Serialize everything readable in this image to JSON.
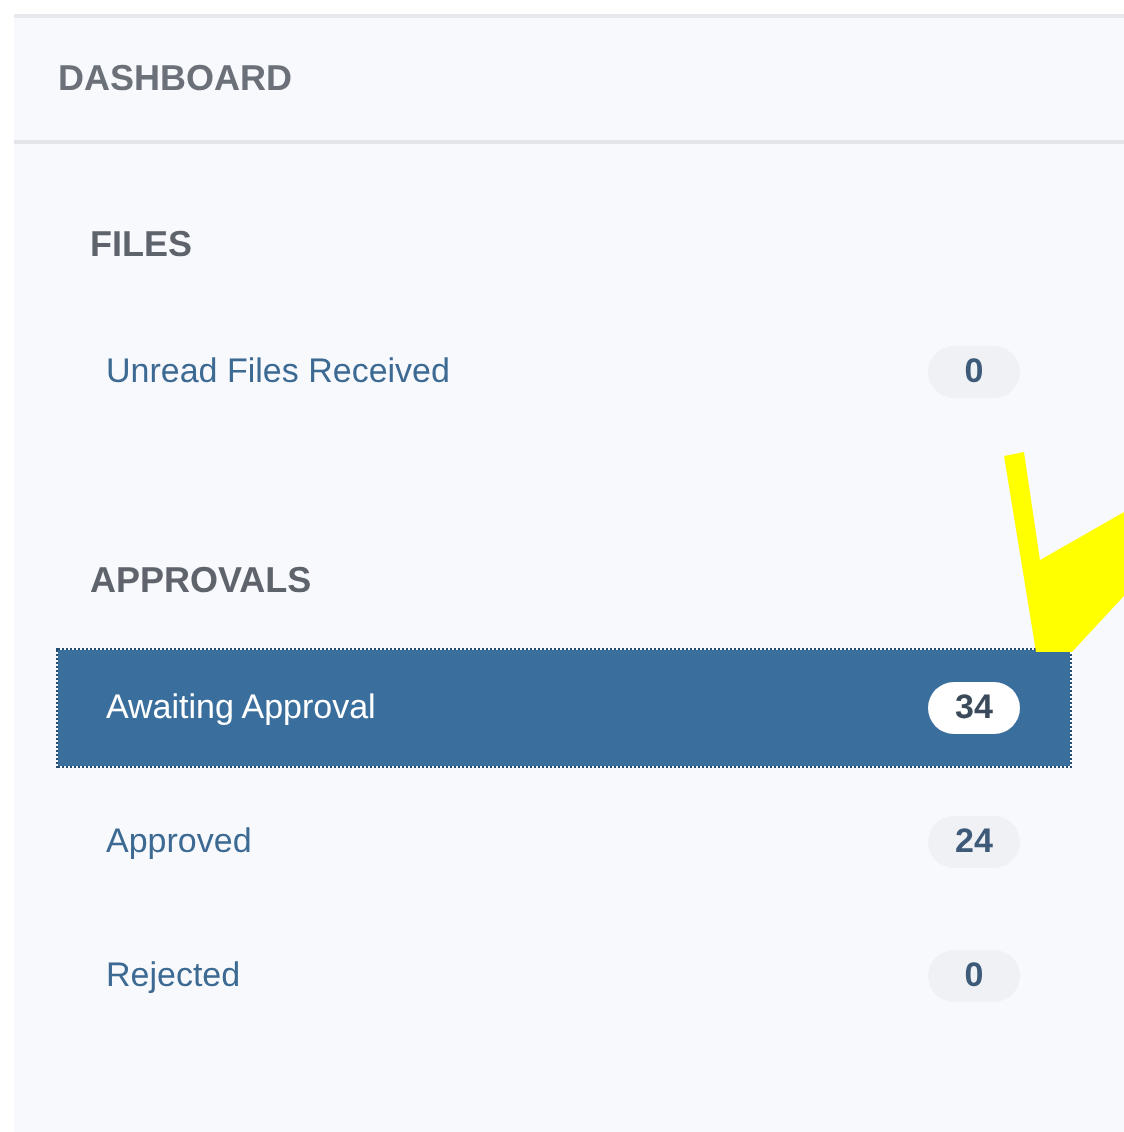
{
  "header": {
    "title": "DASHBOARD"
  },
  "sections": [
    {
      "title": "FILES",
      "items": [
        {
          "label": "Unread Files Received",
          "count": "0",
          "selected": false
        }
      ]
    },
    {
      "title": "APPROVALS",
      "items": [
        {
          "label": "Awaiting Approval",
          "count": "34",
          "selected": true
        },
        {
          "label": "Approved",
          "count": "24",
          "selected": false
        },
        {
          "label": "Rejected",
          "count": "0",
          "selected": false
        }
      ]
    }
  ]
}
